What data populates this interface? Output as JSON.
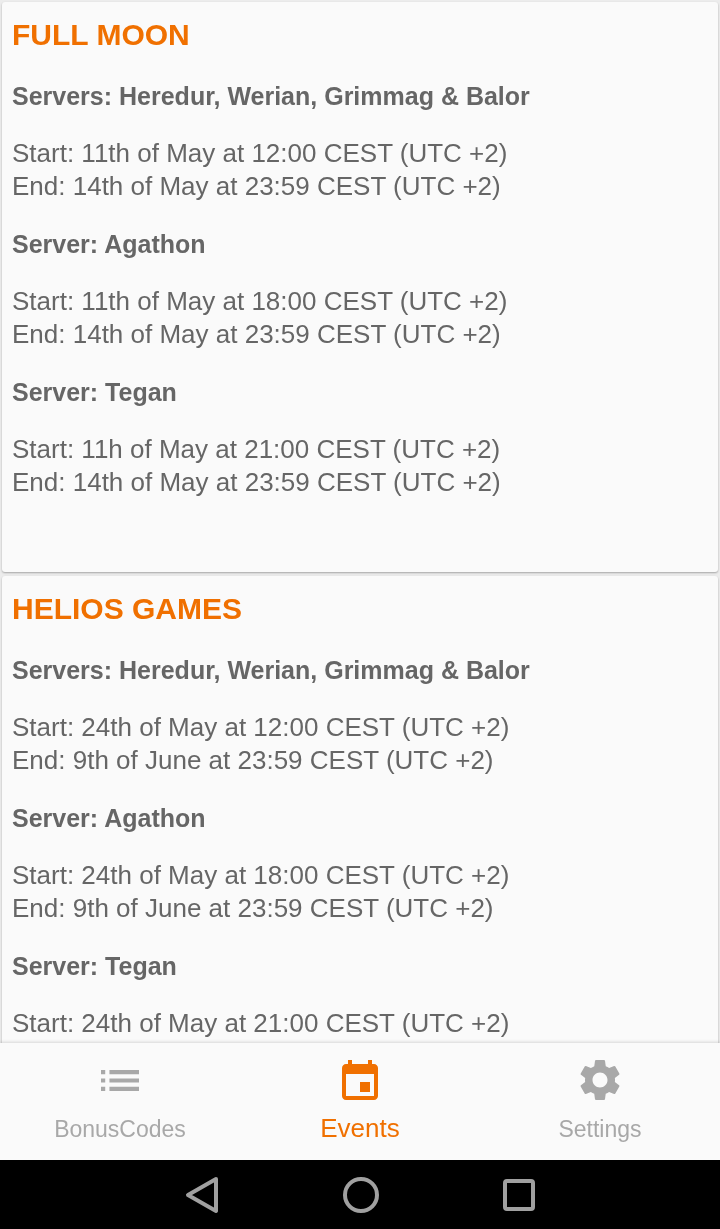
{
  "events": [
    {
      "title": "FULL MOON",
      "schedules": [
        {
          "servers": "Servers: Heredur, Werian, Grimmag & Balor",
          "start": "Start: 11th of May at 12:00 CEST (UTC +2)",
          "end": "End: 14th of May at 23:59 CEST (UTC +2)"
        },
        {
          "servers": "Server: Agathon",
          "start": "Start: 11th of May at 18:00 CEST (UTC +2)",
          "end": "End: 14th of May at 23:59 CEST (UTC +2)"
        },
        {
          "servers": "Server: Tegan",
          "start": "Start: 11h of May at 21:00 CEST (UTC +2)",
          "end": "End: 14th of May at 23:59 CEST (UTC +2)"
        }
      ]
    },
    {
      "title": "HELIOS GAMES",
      "schedules": [
        {
          "servers": "Servers: Heredur, Werian, Grimmag & Balor",
          "start": "Start: 24th of May at 12:00 CEST (UTC +2)",
          "end": "End: 9th of June at 23:59 CEST (UTC +2)"
        },
        {
          "servers": "Server: Agathon",
          "start": "Start: 24th of May at 18:00 CEST (UTC +2)",
          "end": "End: 9th of June at 23:59 CEST (UTC +2)"
        },
        {
          "servers": "Server: Tegan",
          "start": "Start: 24th of May at 21:00 CEST (UTC +2)"
        }
      ]
    }
  ],
  "bottom_nav": [
    {
      "label": "BonusCodes",
      "kind": "list",
      "selected": false
    },
    {
      "label": "Events",
      "kind": "calendar",
      "selected": true
    },
    {
      "label": "Settings",
      "kind": "settings",
      "selected": false
    }
  ]
}
